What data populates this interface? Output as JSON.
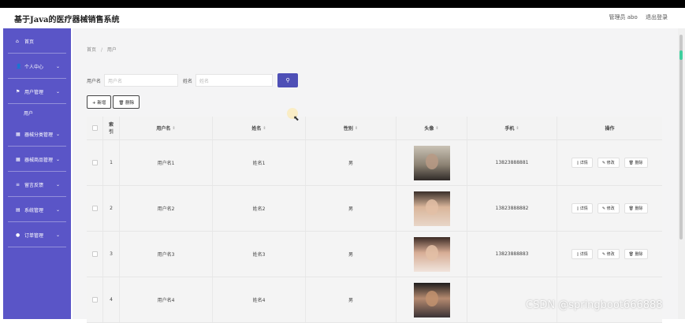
{
  "app": {
    "title": "基于Java的医疗器械销售系统",
    "admin_label": "管理员 abo",
    "logout_label": "退出登录"
  },
  "sidebar": {
    "items": [
      {
        "icon": "home-icon",
        "label": "首页",
        "glyph": "⌂"
      },
      {
        "icon": "user-icon",
        "label": "个人中心",
        "glyph": "👤",
        "chevron": "⌄"
      },
      {
        "icon": "flag-icon",
        "label": "用户管理",
        "glyph": "⚑",
        "chevron": "⌄"
      },
      {
        "icon": "grid-icon",
        "label": "器械分类管理",
        "glyph": "▦",
        "chevron": "⌄"
      },
      {
        "icon": "grid-icon",
        "label": "器械商品管理",
        "glyph": "▦",
        "chevron": "⌄"
      },
      {
        "icon": "list-icon",
        "label": "留言反馈",
        "glyph": "≡",
        "chevron": "⌄"
      },
      {
        "icon": "table-icon",
        "label": "系统管理",
        "glyph": "▤",
        "chevron": "⌄"
      },
      {
        "icon": "pin-icon",
        "label": "订单管理",
        "glyph": "●",
        "chevron": "⌄"
      }
    ],
    "submenu_user": "用户"
  },
  "breadcrumb": {
    "home": "首页",
    "sep": "/",
    "current": "用户"
  },
  "search": {
    "username_label": "用户名",
    "username_placeholder": "用户名",
    "name_label": "姓名",
    "name_placeholder": "姓名",
    "search_icon": "⚲"
  },
  "actions": {
    "add": "+ 新增",
    "delete": "🗑 删除"
  },
  "table": {
    "headers": {
      "index": [
        "索",
        "引"
      ],
      "username": "用户名",
      "name": "姓名",
      "sex": "性别",
      "avatar": "头像",
      "phone": "手机",
      "ops": "操作",
      "sort_glyph": "⇕"
    },
    "rows": [
      {
        "index": "1",
        "username": "用户名1",
        "name": "姓名1",
        "sex": "男",
        "phone": "13823888881"
      },
      {
        "index": "2",
        "username": "用户名2",
        "name": "姓名2",
        "sex": "男",
        "phone": "13823888882"
      },
      {
        "index": "3",
        "username": "用户名3",
        "name": "姓名3",
        "sex": "男",
        "phone": "13823888883"
      },
      {
        "index": "4",
        "username": "用户名4",
        "name": "姓名4",
        "sex": "男",
        "phone": ""
      }
    ],
    "ops": {
      "detail": "▯ 详情",
      "edit": "✎ 修改",
      "delete": "🗑 删除"
    }
  },
  "watermark": "CSDN @springboot666888",
  "colors": {
    "sidebar": "#5a55c7",
    "primary_button": "#4e4fb6",
    "scroll_accent": "#3fcf9e"
  }
}
